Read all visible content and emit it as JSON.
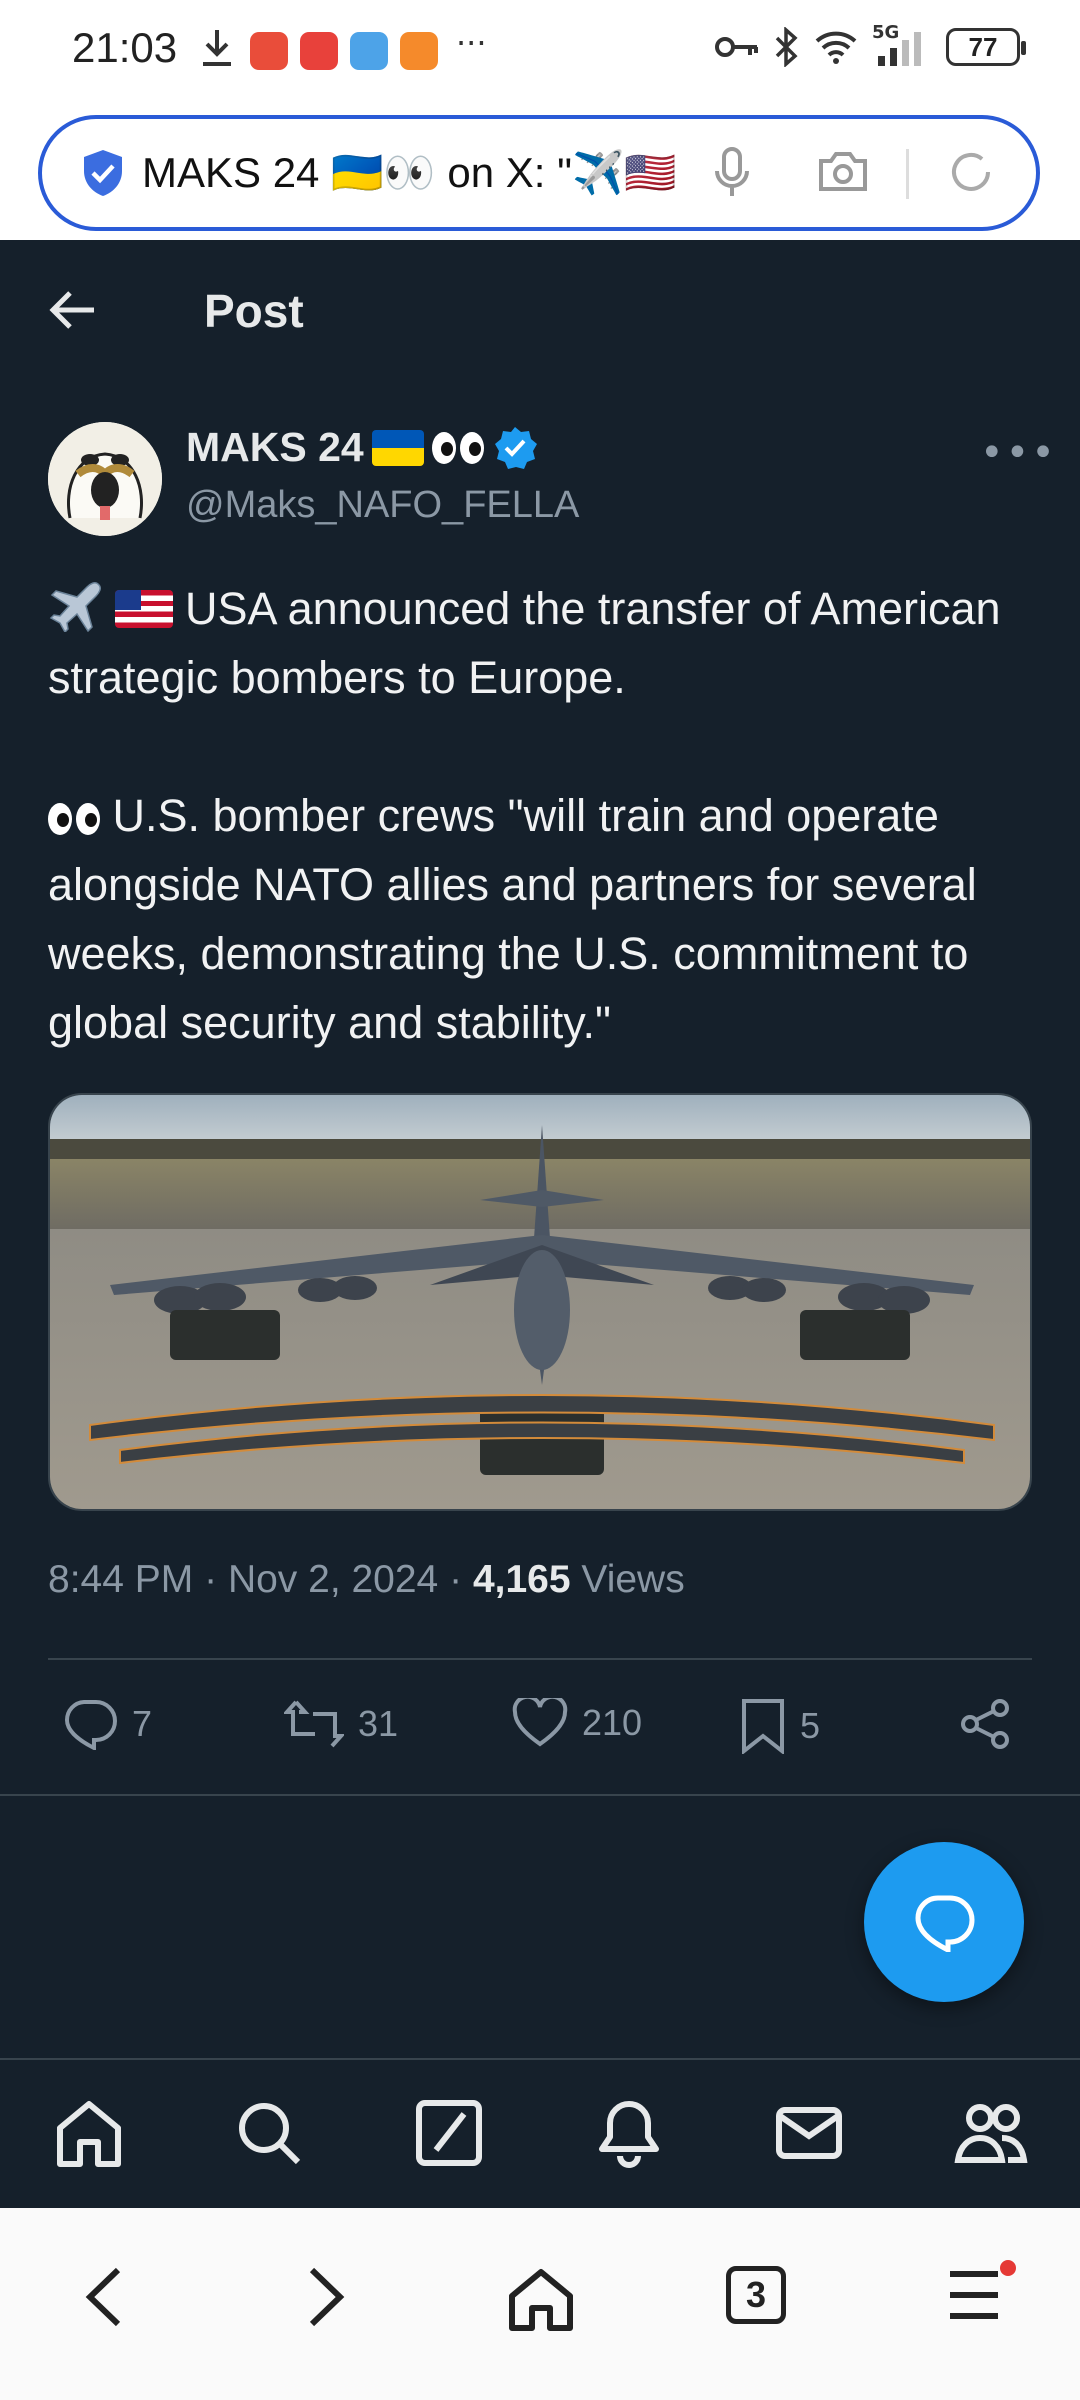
{
  "status_bar": {
    "time": "21:03",
    "network": "5G",
    "battery": "77"
  },
  "browser": {
    "url_text": "MAKS 24 🇺🇦👀 on X: \"✈️🇺🇸",
    "tab_count": "3"
  },
  "header": {
    "title": "Post"
  },
  "post": {
    "author_name": "MAKS 24",
    "author_handle": "@Maks_NAFO_FELLA",
    "paragraph1": "USA announced the transfer of American strategic bombers to Europe.",
    "paragraph2": "U.S. bomber crews \"will train and operate alongside NATO allies and partners for several weeks, demonstrating the U.S. commitment to global security and stability.\"",
    "time": "8:44 PM",
    "date": "Nov 2, 2024",
    "views_count": "4,165",
    "views_label": "Views",
    "sep": "·"
  },
  "actions": {
    "replies": "7",
    "reposts": "31",
    "likes": "210",
    "bookmarks": "5"
  },
  "colors": {
    "background": "#15202b",
    "accent": "#1d9bf0",
    "muted": "#8b98a5",
    "divider": "#38444d"
  }
}
